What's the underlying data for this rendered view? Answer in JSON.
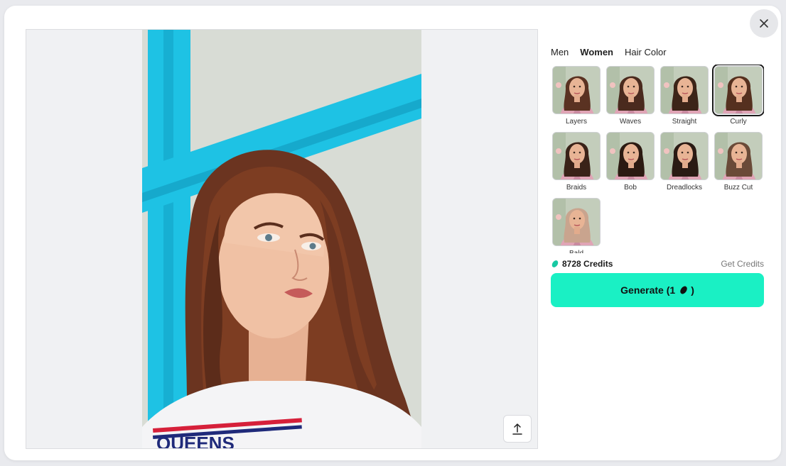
{
  "close_icon": "close-icon",
  "upload_icon": "upload-icon",
  "tabs": [
    {
      "label": "Men",
      "active": false
    },
    {
      "label": "Women",
      "active": true
    },
    {
      "label": "Hair Color",
      "active": false
    }
  ],
  "styles": [
    {
      "label": "Layers",
      "hair": "#5a3222",
      "selected": false
    },
    {
      "label": "Waves",
      "hair": "#4a2a1e",
      "selected": false
    },
    {
      "label": "Straight",
      "hair": "#3c2418",
      "selected": false
    },
    {
      "label": "Curly",
      "hair": "#55301f",
      "selected": true
    },
    {
      "label": "Braids",
      "hair": "#3a2218",
      "selected": false
    },
    {
      "label": "Bob",
      "hair": "#2c1a12",
      "selected": false
    },
    {
      "label": "Dreadlocks",
      "hair": "#2a1a14",
      "selected": false
    },
    {
      "label": "Buzz Cut",
      "hair": "#6a4a38",
      "selected": false
    },
    {
      "label": "Bald",
      "hair": "#c9a48e",
      "selected": false
    }
  ],
  "credits": {
    "amount_label": "8728 Credits",
    "icon": "credit-coin-icon",
    "get_label": "Get Credits"
  },
  "generate": {
    "label": "Generate (1",
    "suffix": ")",
    "icon": "credit-coin-icon"
  },
  "colors": {
    "accent": "#1af0c4",
    "credit_icon": "#18c9a3"
  }
}
